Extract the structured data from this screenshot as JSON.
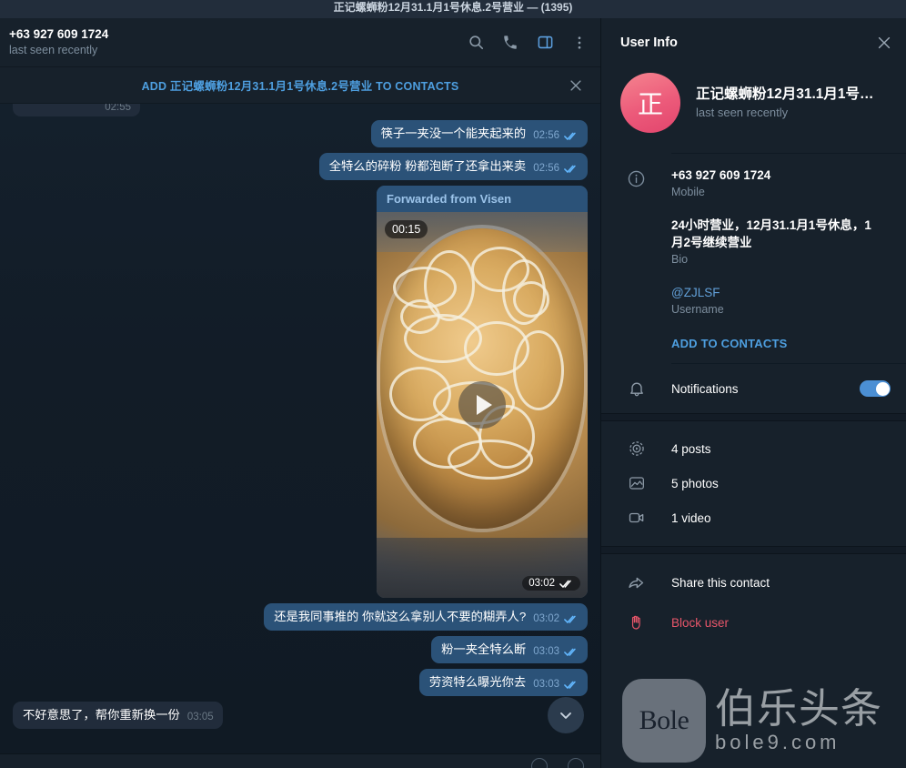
{
  "window": {
    "title": "正记螺蛳粉12月31.1月1号休息.2号营业 — (1395)"
  },
  "chat_header": {
    "peer_name": "+63 927 609 1724",
    "peer_status": "last seen recently",
    "actions": [
      {
        "name": "search-icon",
        "label": "Search"
      },
      {
        "name": "call-icon",
        "label": "Call"
      },
      {
        "name": "info-panel-toggle-icon",
        "label": "Info",
        "active": true
      },
      {
        "name": "more-options-icon",
        "label": "More"
      }
    ]
  },
  "add_contact_bar": {
    "text": "ADD 正记螺蛳粉12月31.1月1号休息.2号营业 TO CONTACTS",
    "close_label": "×"
  },
  "messages": {
    "clipped_top_time": "02:55",
    "items": [
      {
        "direction": "out",
        "text": "筷子一夹没一个能夹起来的",
        "time": "02:56",
        "read": true
      },
      {
        "direction": "out",
        "text": "全特么的碎粉 粉都泡断了还拿出来卖",
        "time": "02:56",
        "read": true
      },
      {
        "direction": "out",
        "text": "还是我同事推的 你就这么拿别人不要的糊弄人?",
        "time": "03:02",
        "read": true
      },
      {
        "direction": "out",
        "text": "粉一夹全特么断",
        "time": "03:03",
        "read": true
      },
      {
        "direction": "out",
        "text": "劳资特么曝光你去",
        "time": "03:03",
        "read": true
      },
      {
        "direction": "in",
        "text": "不好意思了，帮你重新换一份",
        "time": "03:05",
        "read": false
      }
    ],
    "video": {
      "forwarded_from": "Forwarded from Visen",
      "duration": "00:15",
      "time": "03:02",
      "read": true,
      "play_label": "Play"
    },
    "scroll_down_label": "Scroll to bottom"
  },
  "info_panel": {
    "title": "User Info",
    "close_label": "×",
    "avatar_initial": "正",
    "avatar_color": "#ec5a7a",
    "profile_name": "正记螺蛳粉12月31.1月1号…",
    "profile_status": "last seen recently",
    "details": {
      "phone_value": "+63 927 609 1724",
      "phone_label": "Mobile",
      "bio_value": "24小时营业，12月31.1月1号休息，1月2号继续营业",
      "bio_label": "Bio",
      "username_value": "@ZJLSF",
      "username_label": "Username",
      "add_to_contacts": "ADD TO CONTACTS"
    },
    "notifications": {
      "label": "Notifications",
      "enabled": true
    },
    "media": [
      {
        "icon": "posts-icon",
        "label": "4 posts"
      },
      {
        "icon": "photos-icon",
        "label": "5 photos"
      },
      {
        "icon": "video-icon",
        "label": "1 video"
      }
    ],
    "actions": [
      {
        "icon": "share-icon",
        "label": "Share this contact",
        "danger": false
      },
      {
        "icon": "block-hand-icon",
        "label": "Block user",
        "danger": true
      }
    ]
  },
  "watermark": {
    "badge_text": "Bole",
    "cn_text": "伯乐头条",
    "url_text": "bole9.com"
  }
}
